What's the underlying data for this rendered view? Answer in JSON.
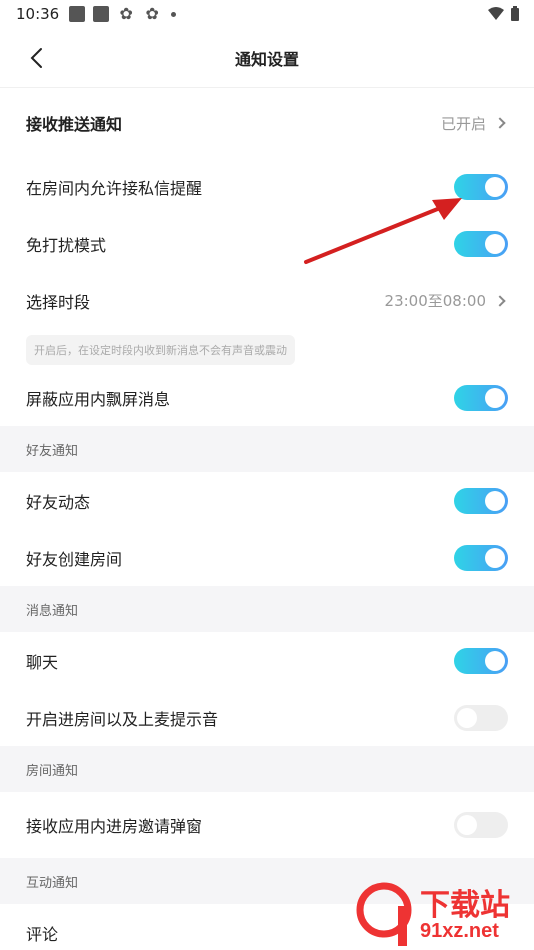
{
  "status_bar": {
    "time": "10:36"
  },
  "nav": {
    "title": "通知设置"
  },
  "rows": {
    "receive_push": {
      "label": "接收推送通知",
      "value": "已开启"
    },
    "allow_dm": {
      "label": "在房间内允许接私信提醒",
      "toggle": "on"
    },
    "dnd": {
      "label": "免打扰模式",
      "toggle": "on"
    },
    "time_range": {
      "label": "选择时段",
      "value": "23:00至08:00"
    },
    "hint": "开启后，在设定时段内收到新消息不会有声音或震动",
    "block_float": {
      "label": "屏蔽应用内飘屏消息",
      "toggle": "on"
    }
  },
  "sections": {
    "friends": {
      "title": "好友通知",
      "items": [
        {
          "label": "好友动态",
          "toggle": "on"
        },
        {
          "label": "好友创建房间",
          "toggle": "on"
        }
      ]
    },
    "messages": {
      "title": "消息通知",
      "items": [
        {
          "label": "聊天",
          "toggle": "on"
        },
        {
          "label": "开启进房间以及上麦提示音",
          "toggle": "off"
        }
      ]
    },
    "room": {
      "title": "房间通知",
      "items": [
        {
          "label": "接收应用内进房邀请弹窗",
          "toggle": "off"
        }
      ]
    },
    "interact": {
      "title": "互动通知",
      "items": [
        {
          "label": "评论"
        }
      ]
    }
  },
  "watermark": {
    "brand": "下载站",
    "domain": "91xz.net"
  },
  "colors": {
    "toggle_on_start": "#2fd3e6",
    "toggle_on_end": "#4a9ff5",
    "toggle_off": "#eeeeee",
    "arrow": "#d42020"
  }
}
